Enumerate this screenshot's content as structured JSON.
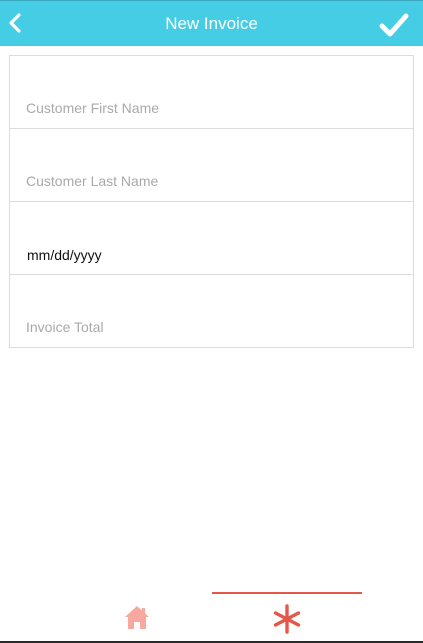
{
  "header": {
    "title": "New Invoice",
    "back_icon": "chevron-left-icon",
    "confirm_icon": "checkmark-icon",
    "background_color": "#46cde6"
  },
  "form": {
    "first_name": {
      "placeholder": "Customer First Name",
      "value": ""
    },
    "last_name": {
      "placeholder": "Customer Last Name",
      "value": ""
    },
    "date": {
      "display": "mm/dd/yyyy"
    },
    "total": {
      "placeholder": "Invoice Total",
      "value": ""
    }
  },
  "tabbar": {
    "tabs": [
      {
        "icon": "home-icon",
        "color": "#f7a9a0",
        "active": false
      },
      {
        "icon": "asterisk-icon",
        "color": "#e4574a",
        "active": true
      }
    ],
    "accent_color": "#e4574a"
  }
}
